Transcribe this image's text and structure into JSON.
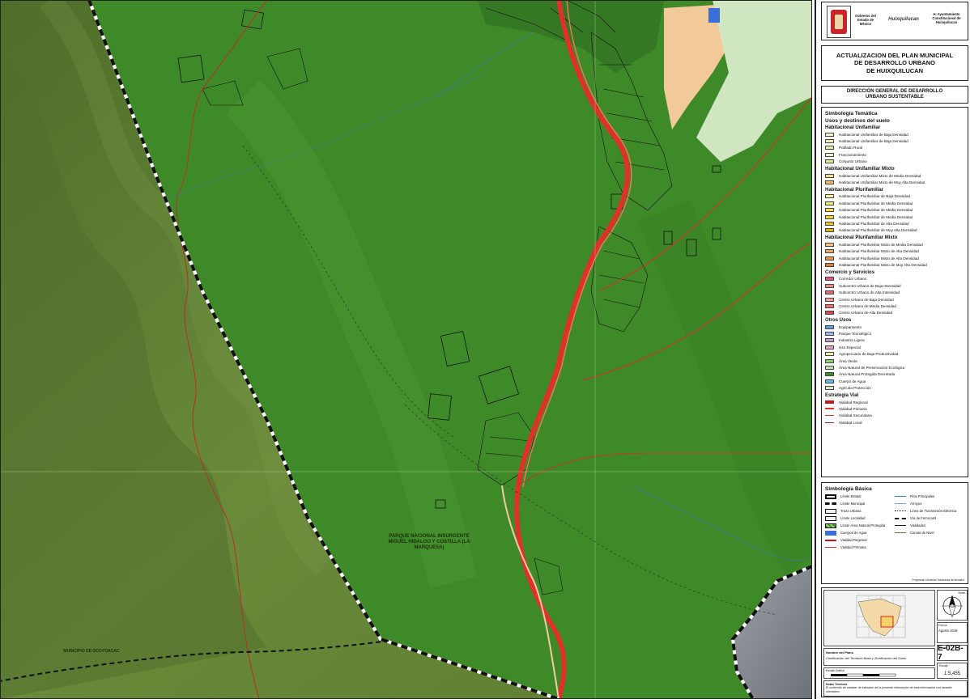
{
  "header": {
    "logo_text_1": "Gobierno del Estado de México",
    "logo_text_2": "Huixquilucan",
    "logo_text_3": "H. Ayuntamiento Constitucional de Huixquilucan",
    "title": "ACTUALIZACION DEL PLAN MUNICIPAL\nDE DESARROLLO URBANO\nDE HUIXQUILUCAN",
    "department": "DIRECCIÓN GENERAL DE DESARROLLO\nURBANO SUSTENTABLE"
  },
  "map": {
    "park_label": "PARQUE NACIONAL INSURGENTE MIGUEL HIDALGO Y COSTILLA (LA MARQUESA)",
    "muni_label": "MUNICIPIO DE OCOYOACAC",
    "colors": {
      "protected_area": "#3f8a28",
      "terrain": "#5b7a2f",
      "urban": "#f2c999",
      "regional_road": "#e0302a",
      "local_road": "#c8362e",
      "stream": "#3a78c9",
      "boundary": "#111111"
    }
  },
  "legend": {
    "title": "Simbología Temática",
    "subtitle": "Usos y destinos del suelo",
    "groups": [
      {
        "name": "Habitacional Unifamiliar",
        "items": [
          {
            "label": "Habitacional Unifamiliar de Baja Densidad",
            "color": "#f7f3c8"
          },
          {
            "label": "Habitacional Unifamiliar de Baja Densidad",
            "color": "#f5ecb0"
          },
          {
            "label": "Poblado Rural",
            "color": "#efe7a4"
          },
          {
            "label": "Fraccionamiento",
            "color": "#f1f1d8"
          },
          {
            "label": "Conjunto Urbano",
            "color": "#e4e69a"
          }
        ]
      },
      {
        "name": "Habitacional Unifamiliar Mixto",
        "items": [
          {
            "label": "Habitacional Unifamiliar Mixto de Media Densidad",
            "color": "#f7d98a"
          },
          {
            "label": "Habitacional Unifamiliar Mixto de Muy Alta Densidad",
            "color": "#f3b866"
          }
        ]
      },
      {
        "name": "Habitacional Plurifamiliar",
        "items": [
          {
            "label": "Habitacional Plurifamiliar de Baja Densidad",
            "color": "#fbf3a0"
          },
          {
            "label": "Habitacional Plurifamiliar de Media Densidad",
            "color": "#f8e878"
          },
          {
            "label": "Habitacional Plurifamiliar de Media Densidad",
            "color": "#f4dd58"
          },
          {
            "label": "Habitacional Plurifamiliar de Media Densidad",
            "color": "#f0d23a"
          },
          {
            "label": "Habitacional Plurifamiliar de Alta Densidad",
            "color": "#e8c424"
          },
          {
            "label": "Habitacional Plurifamiliar de Muy Alta Densidad",
            "color": "#dcb510"
          }
        ]
      },
      {
        "name": "Habitacional Plurifamiliar Mixto",
        "items": [
          {
            "label": "Habitacional Plurifamiliar Mixto de Media Densidad",
            "color": "#f7c27a"
          },
          {
            "label": "Habitacional Plurifamiliar Mixto de Alta Densidad",
            "color": "#f3a85a"
          },
          {
            "label": "Habitacional Plurifamiliar Mixto de Alta Densidad",
            "color": "#ec8f40"
          },
          {
            "label": "Habitacional Plurifamiliar Mixto de Muy Alta Densidad",
            "color": "#e0782c"
          }
        ]
      },
      {
        "name": "Comercio y Servicios",
        "items": [
          {
            "label": "Corredor Urbano",
            "color": "#e8546c"
          },
          {
            "label": "Subcentro Urbano de Baja Intensidad",
            "color": "#f08a8a"
          },
          {
            "label": "Subcentro Urbano de Alta Intensidad",
            "color": "#e86a6a"
          },
          {
            "label": "Centro Urbano de Baja Densidad",
            "color": "#f4a0a0"
          },
          {
            "label": "Centro Urbano de Media Densidad",
            "color": "#ec7070"
          },
          {
            "label": "Centro Urbano de Alta Densidad",
            "color": "#d84848"
          }
        ]
      },
      {
        "name": "Otros Usos",
        "items": [
          {
            "label": "Equipamiento",
            "color": "#5aa0e0"
          },
          {
            "label": "Parque Tecnológico",
            "color": "#9fb7f0"
          },
          {
            "label": "Industria Ligera",
            "color": "#c49ad8"
          },
          {
            "label": "Uso Especial",
            "color": "#f0a0d0"
          },
          {
            "label": "Agropecuario de Baja Productividad",
            "color": "#e8f0b0"
          },
          {
            "label": "Área Verde",
            "color": "#8fd06a"
          },
          {
            "label": "Área Natural de Preservación Ecológica",
            "color": "#bfe6a8"
          },
          {
            "label": "Área Natural Protegida Decretada",
            "color": "#3f8a28"
          },
          {
            "label": "Cuerpo de Agua",
            "color": "#6ab8f0"
          },
          {
            "label": "Agrícola Protección",
            "color": "#d8ecc8"
          }
        ]
      }
    ],
    "strategy": {
      "name": "Estrategia Vial",
      "items": [
        {
          "label": "Vialidad Regional",
          "color": "#c4161c",
          "width": 4
        },
        {
          "label": "Vialidad Primaria",
          "color": "#e0302a",
          "width": 2
        },
        {
          "label": "Vialidad Secundaria",
          "color": "#c8362e",
          "width": 1.5
        },
        {
          "label": "Vialidad Local",
          "color": "#a82a26",
          "width": 1
        }
      ]
    }
  },
  "basic_legend": {
    "title": "Simbología Básica",
    "left": [
      {
        "label": "Límite Estatal",
        "sym": "thick"
      },
      {
        "label": "Límite Municipal",
        "sym": "dash"
      },
      {
        "label": "Traza Urbana",
        "sym": "box"
      },
      {
        "label": "Límite Localidad",
        "sym": "box"
      },
      {
        "label": "Límite Área Natural Protegida",
        "sym": "hatch"
      },
      {
        "label": "Cuerpos de Agua",
        "sym": "water"
      },
      {
        "label": "Vialidad Regional",
        "sym": "redthick"
      },
      {
        "label": "Vialidad Primaria",
        "sym": "redthin"
      }
    ],
    "right": [
      {
        "label": "Ríos Principales",
        "sym": "blue"
      },
      {
        "label": "Arroyos",
        "sym": "bluethin"
      },
      {
        "label": "Línea de Transmisión Eléctrica",
        "sym": "dotline"
      },
      {
        "label": "Vía de Ferrocarril",
        "sym": "rail"
      },
      {
        "label": "Vialidades",
        "sym": "black"
      },
      {
        "label": "Curvas de Nivel",
        "sym": "contour"
      }
    ],
    "note": "Proyección Universal Transversa de Mercator"
  },
  "sheet": {
    "north_label": "Norte",
    "date_label": "Fecha",
    "date": "Agosto 2018",
    "code_label": "Clave",
    "code": "E-02B-7",
    "scale_label": "Escala",
    "scale": "1:5,455",
    "plane_label": "Nombre del Plano",
    "plane_name": "Clasificación del Territorio Base y Zonificación del Suelo",
    "scale_bar_label": "Escala Gráfica",
    "notes_label": "Notas Técnicas",
    "notes": "El contenido de carácter de indicador de la presente información de esta información con carácter orientativo."
  }
}
